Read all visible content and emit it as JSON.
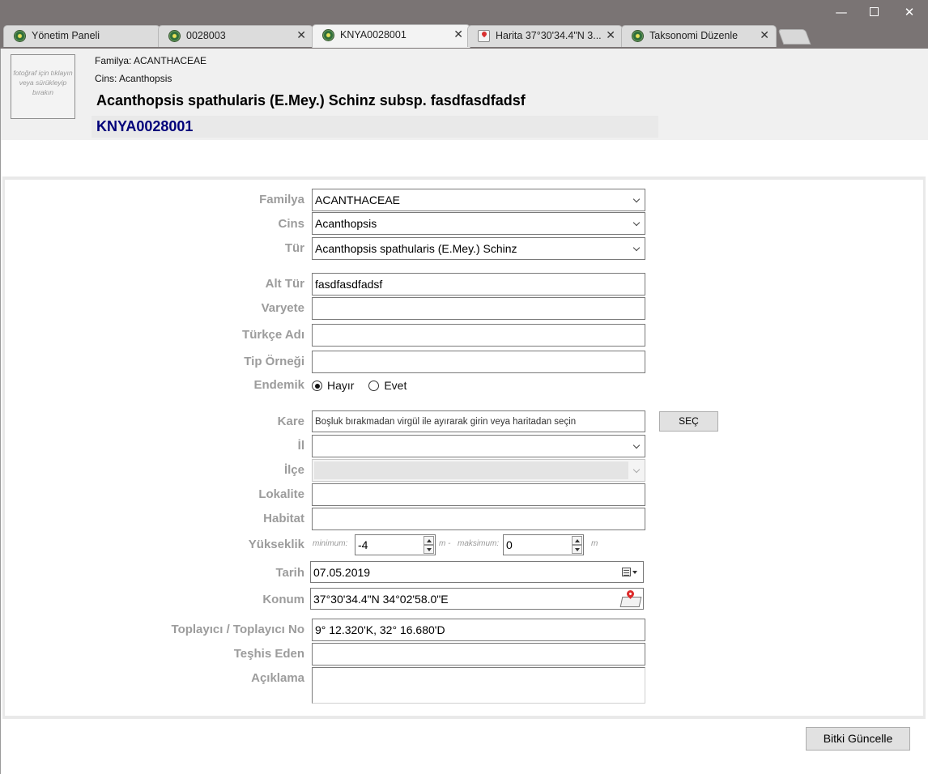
{
  "window": {
    "minimize": "—",
    "close": "✕"
  },
  "tabs": [
    {
      "label": "Yönetim Paneli"
    },
    {
      "label": "0028003"
    },
    {
      "label": "KNYA0028001"
    },
    {
      "label": "Harita 37°30'34.4\"N 3..."
    },
    {
      "label": "Taksonomi Düzenle"
    }
  ],
  "tab_close": "✕",
  "header": {
    "photo_hint": "fotoğraf için tıklayın veya sürükleyip bırakın",
    "family": "Familya: ACANTHACEAE",
    "genus": "Cins: Acanthopsis",
    "title": "Acanthopsis spathularis (E.Mey.) Schinz subsp. fasdfasdfadsf",
    "code": "KNYA0028001"
  },
  "form": {
    "familya": {
      "label": "Familya",
      "value": "ACANTHACEAE"
    },
    "cins": {
      "label": "Cins",
      "value": "Acanthopsis"
    },
    "tur": {
      "label": "Tür",
      "value": "Acanthopsis spathularis (E.Mey.) Schinz"
    },
    "alt_tur": {
      "label": "Alt Tür",
      "value": "fasdfasdfadsf"
    },
    "varyete": {
      "label": "Varyete",
      "value": ""
    },
    "turkce_adi": {
      "label": "Türkçe Adı",
      "value": ""
    },
    "tip_ornegi": {
      "label": "Tip Örneği",
      "value": ""
    },
    "endemik": {
      "label": "Endemik",
      "options": [
        "Hayır",
        "Evet"
      ],
      "selected": "Hayır"
    },
    "kare": {
      "label": "Kare",
      "placeholder": "Boşluk bırakmadan virgül ile ayırarak girin veya haritadan seçin",
      "button": "SEÇ"
    },
    "il": {
      "label": "İl",
      "value": ""
    },
    "ilce": {
      "label": "İlçe",
      "value": ""
    },
    "lokalite": {
      "label": "Lokalite",
      "value": ""
    },
    "habitat": {
      "label": "Habitat",
      "value": ""
    },
    "yukseklik": {
      "label": "Yükseklik",
      "min_label": "minimum:",
      "min_value": "-4",
      "sep_label": "m -",
      "max_label": "maksimum:",
      "max_value": "0",
      "unit": "m"
    },
    "tarih": {
      "label": "Tarih",
      "value": "07.05.2019"
    },
    "konum": {
      "label": "Konum",
      "value": "37°30'34.4\"N 34°02'58.0\"E"
    },
    "toplayici": {
      "label": "Toplayıcı / Toplayıcı No",
      "value": "9° 12.320'K, 32° 16.680'D"
    },
    "teshis_eden": {
      "label": "Teşhis Eden",
      "value": ""
    },
    "aciklama": {
      "label": "Açıklama",
      "value": ""
    }
  },
  "actions": {
    "update": "Bitki Güncelle"
  }
}
